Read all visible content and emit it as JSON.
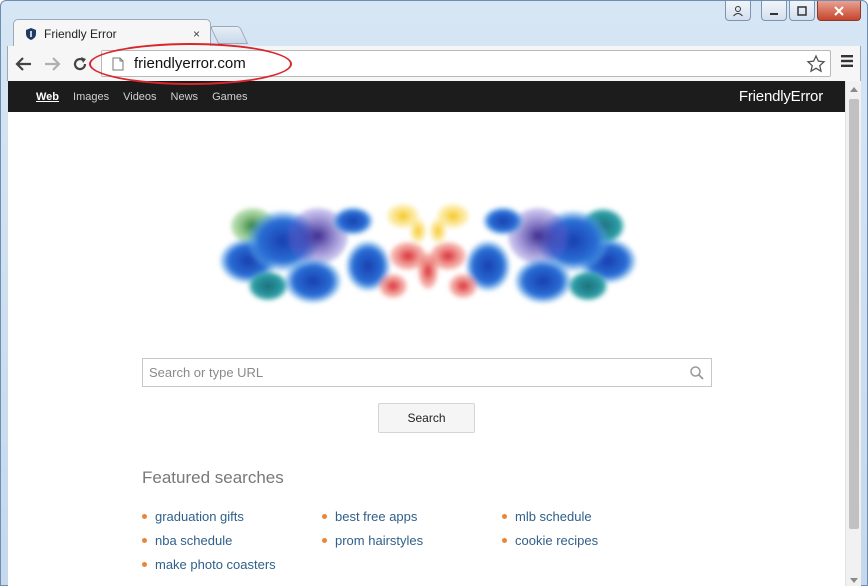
{
  "browser": {
    "tab_title": "Friendly Error",
    "tab_close": "×",
    "url": "friendlyerror.com"
  },
  "topnav": {
    "links": [
      "Web",
      "Images",
      "Videos",
      "News",
      "Games"
    ],
    "active_index": 0,
    "brand": "FriendlyError"
  },
  "search": {
    "placeholder": "Search or type URL",
    "button_label": "Search"
  },
  "featured": {
    "title": "Featured searches",
    "items": [
      "graduation gifts",
      "best free apps",
      "mlb schedule",
      "nba schedule",
      "prom hairstyles",
      "cookie recipes",
      "make photo coasters"
    ]
  },
  "colors": {
    "nav_bg": "#1c1c1c",
    "link": "#2f5f8a",
    "bullet": "#e8873a",
    "annotation": "#d9262c"
  }
}
